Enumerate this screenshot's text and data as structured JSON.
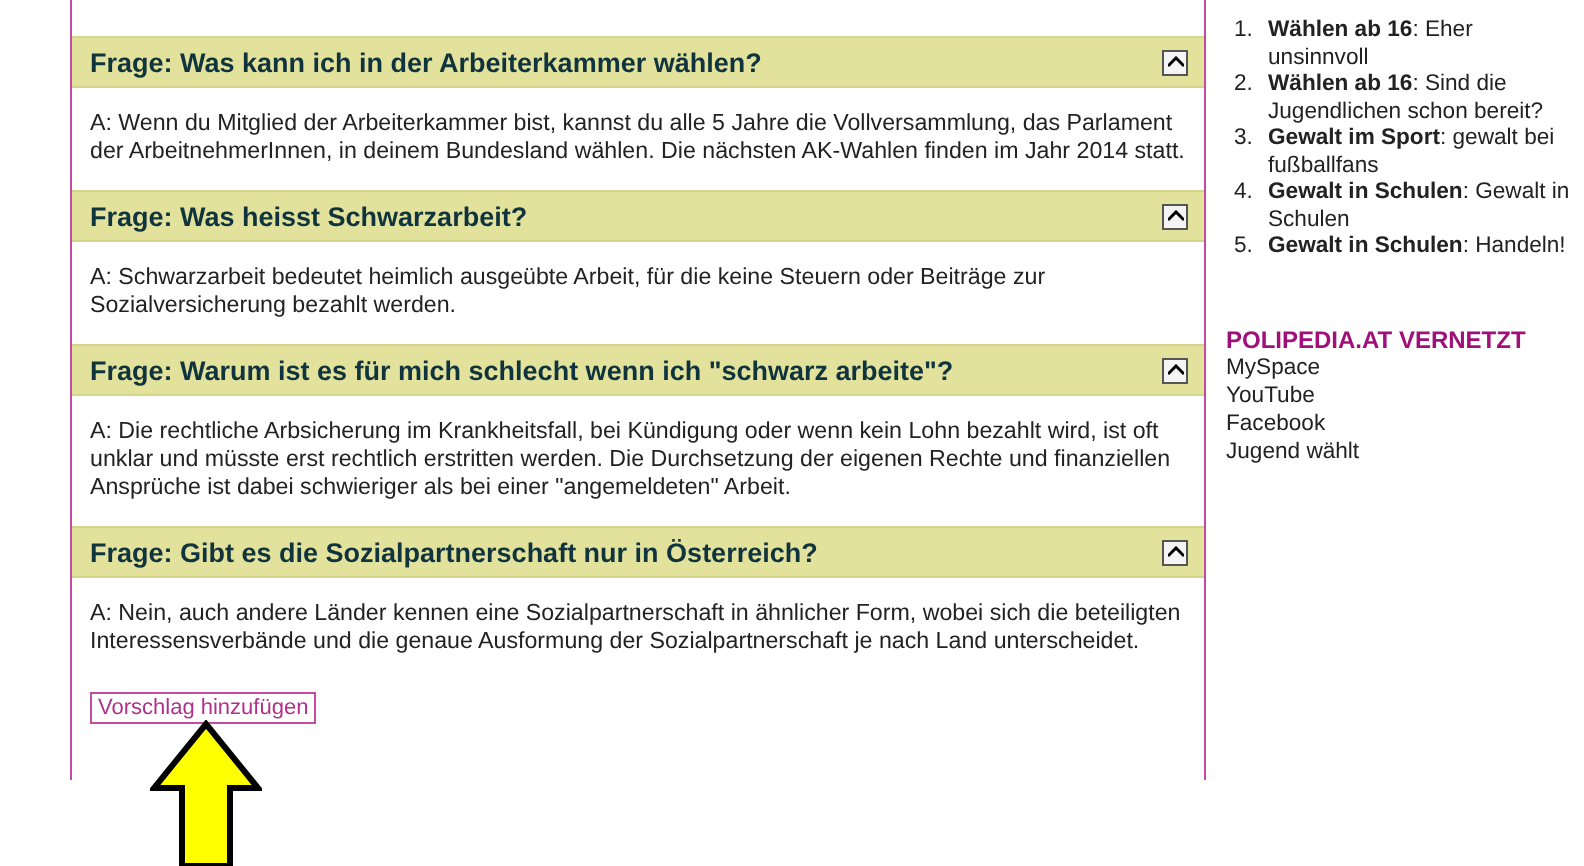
{
  "faq": [
    {
      "question": "Frage: Was kann ich in der Arbeiterkammer wählen?",
      "expanded": true,
      "answer": "A:  Wenn du Mitglied der Arbeiterkammer bist, kannst du alle 5 Jahre die Vollversammlung, das Parlament der ArbeitnehmerInnen, in deinem Bundesland wählen. Die nächsten AK-Wahlen finden im Jahr 2014 statt."
    },
    {
      "question": "Frage: Was heisst Schwarzarbeit?",
      "expanded": true,
      "answer": "A:  Schwarzarbeit bedeutet heimlich ausgeübte Arbeit, für die keine Steuern oder Beiträge zur Sozialversicherung bezahlt werden."
    },
    {
      "question": "Frage: Warum ist es für mich schlecht wenn ich \"schwarz arbeite\"?",
      "expanded": true,
      "answer": "A:  Die rechtliche Arbsicherung im Krankheitsfall, bei Kündigung oder wenn kein Lohn bezahlt wird, ist oft unklar und müsste erst rechtlich erstritten werden. Die Durchsetzung der eigenen Rechte und finanziellen Ansprüche ist dabei schwieriger als bei einer \"angemeldeten\" Arbeit."
    },
    {
      "question": "Frage: Gibt es die Sozialpartnerschaft nur in Österreich?",
      "expanded": true,
      "answer": "A:  Nein, auch andere Länder kennen eine Sozialpartnerschaft in ähnlicher Form, wobei sich die beteiligten Interessensverbände und die genaue Ausformung der Sozialpartnerschaft je nach Land unterscheidet."
    }
  ],
  "suggest_button": "Vorschlag hinzufügen",
  "sidebar": {
    "ranking": [
      {
        "marker": "1.",
        "text": "**Wählen ab 16**: Eher unsinnvoll"
      },
      {
        "marker": "2.",
        "text": "**Wählen ab 16**: Sind die Jugendlichen schon bereit?"
      },
      {
        "marker": "3.",
        "text": "**Gewalt im Sport**: gewalt bei fußballfans"
      },
      {
        "marker": "4.",
        "text": "**Gewalt in Schulen**: Gewalt in Schulen"
      },
      {
        "marker": "5.",
        "text": "**Gewalt in Schulen**: Handeln!"
      }
    ],
    "network_heading": "POLIPEDIA.AT VERNETZT",
    "network_links": [
      "MySpace",
      "YouTube",
      "Facebook",
      "Jugend wählt"
    ]
  }
}
